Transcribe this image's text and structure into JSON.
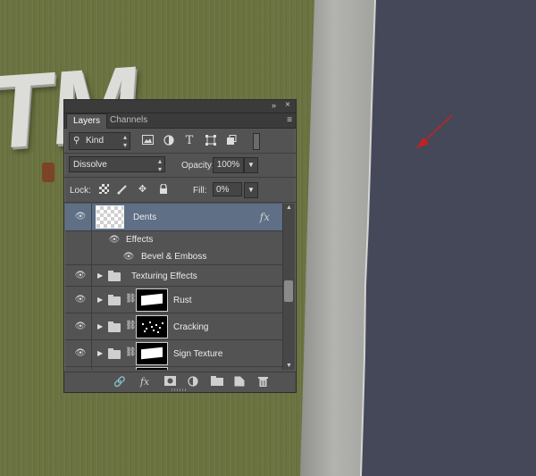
{
  "canvas": {
    "sign_text": "TM",
    "colors": {
      "grass": "#6b7441",
      "concrete": "#a9a9a5",
      "wall": "#454858",
      "arrow": "#c8201e"
    }
  },
  "panel": {
    "collapse_icon": "»",
    "close_icon": "×",
    "tabs": [
      {
        "label": "Layers",
        "active": true
      },
      {
        "label": "Channels",
        "active": false
      }
    ],
    "menu_icon": "≡",
    "filter": {
      "kind_label": "Kind",
      "icons": [
        "image-filter-icon",
        "adjustment-filter-icon",
        "type-filter-icon",
        "shape-filter-icon",
        "smart-object-filter-icon"
      ]
    },
    "blend": {
      "mode": "Dissolve",
      "opacity_label": "Opacity:",
      "opacity_value": "100%"
    },
    "lock": {
      "label": "Lock:",
      "icons": [
        "lock-transparent-pixels-icon",
        "lock-image-pixels-icon",
        "lock-position-icon",
        "lock-all-icon"
      ],
      "fill_label": "Fill:",
      "fill_value": "0%"
    },
    "layers": [
      {
        "name": "Dents",
        "type": "layer",
        "visible": true,
        "selected": true,
        "fx": "fx"
      },
      {
        "name": "Effects",
        "type": "effects-header",
        "visible": true
      },
      {
        "name": "Bevel & Emboss",
        "type": "effect",
        "visible": true
      },
      {
        "name": "Texturing Effects",
        "type": "group",
        "visible": true,
        "mask": false
      },
      {
        "name": "Rust",
        "type": "group",
        "visible": true,
        "mask": true
      },
      {
        "name": "Cracking",
        "type": "group",
        "visible": true,
        "mask": true
      },
      {
        "name": "Sign Texture",
        "type": "group",
        "visible": true,
        "mask": true
      }
    ],
    "bottom_icons": [
      "link-layers-icon",
      "add-layer-style-icon",
      "add-mask-icon",
      "new-adjustment-layer-icon",
      "new-group-icon",
      "new-layer-icon",
      "delete-layer-icon"
    ]
  }
}
